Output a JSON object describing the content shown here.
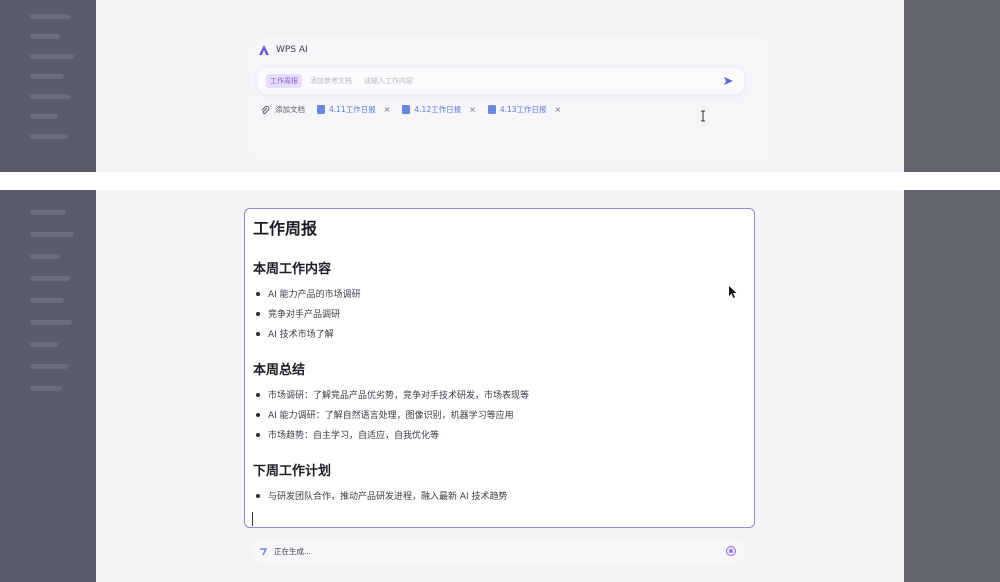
{
  "ai_panel": {
    "title": "WPS AI",
    "tag": "工作周报",
    "input_placeholder": "添加参考文档",
    "input_hint": "或输入工作内容",
    "add_doc_label": "添加文档",
    "attached_docs": [
      {
        "label": "4.11工作日报"
      },
      {
        "label": "4.12工作日报"
      },
      {
        "label": "4.13工作日报"
      }
    ],
    "close_glyph": "×"
  },
  "document": {
    "title": "工作周报",
    "sections": [
      {
        "heading": "本周工作内容",
        "items": [
          "AI 能力产品的市场调研",
          "竞争对手产品调研",
          "AI 技术市场了解"
        ]
      },
      {
        "heading": "本周总结",
        "items": [
          "市场调研：了解竞品产品优劣势，竞争对手技术研发，市场表现等",
          "AI 能力调研：了解自然语言处理，图像识别，机器学习等应用",
          "市场趋势：自主学习，自适应，自我优化等"
        ]
      },
      {
        "heading": "下周工作计划",
        "items": [
          "与研发团队合作，推动产品研发进程，融入最新 AI 技术趋势"
        ]
      }
    ]
  },
  "generation": {
    "status_text": "正在生成..."
  },
  "colors": {
    "accent": "#9a84e0",
    "link": "#5b7ad6",
    "tag_bg": "#e7defa"
  }
}
